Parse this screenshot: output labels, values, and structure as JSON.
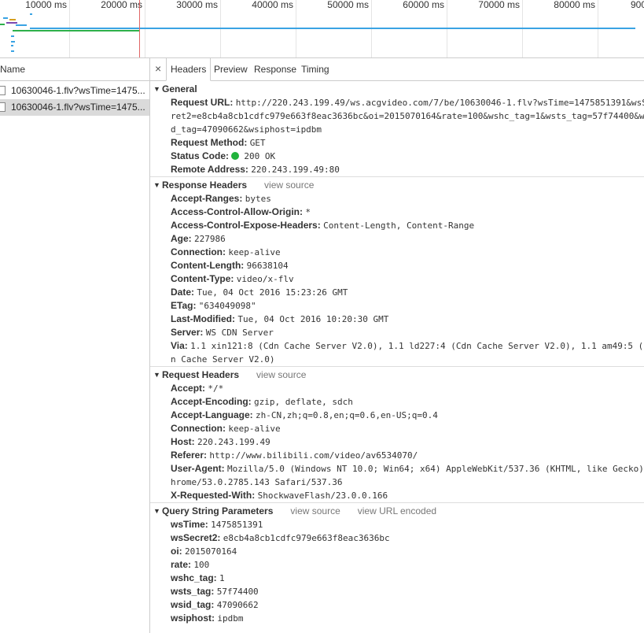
{
  "overview": {
    "ticks": [
      "10000 ms",
      "20000 ms",
      "30000 ms",
      "40000 ms",
      "50000 ms",
      "60000 ms",
      "70000 ms",
      "80000 ms",
      "900"
    ]
  },
  "request_list": {
    "header": "Name",
    "rows": [
      "10630046-1.flv?wsTime=1475...",
      "10630046-1.flv?wsTime=1475..."
    ]
  },
  "tabs": {
    "close": "×",
    "items": [
      "Headers",
      "Preview",
      "Response",
      "Timing"
    ],
    "active": "Headers"
  },
  "general": {
    "title": "General",
    "request_url_label": "Request URL:",
    "request_url_l1": "http://220.243.199.49/ws.acgvideo.com/7/be/10630046-1.flv?wsTime=1475851391&wsS",
    "request_url_l2": "ret2=e8cb4a8cb1cdfc979e663f8eac3636bc&oi=2015070164&rate=100&wshc_tag=1&wsts_tag=57f74400&w",
    "request_url_l3": "d_tag=47090662&wsiphost=ipdbm",
    "method_label": "Request Method:",
    "method": "GET",
    "status_label": "Status Code:",
    "status": "200 OK",
    "remote_label": "Remote Address:",
    "remote": "220.243.199.49:80"
  },
  "response_headers": {
    "title": "Response Headers",
    "view_source": "view source",
    "items": [
      {
        "k": "Accept-Ranges:",
        "v": "bytes"
      },
      {
        "k": "Access-Control-Allow-Origin:",
        "v": "*"
      },
      {
        "k": "Access-Control-Expose-Headers:",
        "v": "Content-Length, Content-Range"
      },
      {
        "k": "Age:",
        "v": "227986"
      },
      {
        "k": "Connection:",
        "v": "keep-alive"
      },
      {
        "k": "Content-Length:",
        "v": "96638104"
      },
      {
        "k": "Content-Type:",
        "v": "video/x-flv"
      },
      {
        "k": "Date:",
        "v": "Tue, 04 Oct 2016 15:23:26 GMT"
      },
      {
        "k": "ETag:",
        "v": "\"634049098\""
      },
      {
        "k": "Last-Modified:",
        "v": "Tue, 04 Oct 2016 10:20:30 GMT"
      },
      {
        "k": "Server:",
        "v": "WS CDN Server"
      },
      {
        "k": "Via:",
        "v": "1.1 xin121:8 (Cdn Cache Server V2.0), 1.1 ld227:4 (Cdn Cache Server V2.0), 1.1 am49:5 ("
      }
    ],
    "via_cont": "n Cache Server V2.0)"
  },
  "request_headers": {
    "title": "Request Headers",
    "view_source": "view source",
    "items": [
      {
        "k": "Accept:",
        "v": "*/*"
      },
      {
        "k": "Accept-Encoding:",
        "v": "gzip, deflate, sdch"
      },
      {
        "k": "Accept-Language:",
        "v": "zh-CN,zh;q=0.8,en;q=0.6,en-US;q=0.4"
      },
      {
        "k": "Connection:",
        "v": "keep-alive"
      },
      {
        "k": "Host:",
        "v": "220.243.199.49"
      },
      {
        "k": "Referer:",
        "v": "http://www.bilibili.com/video/av6534070/"
      },
      {
        "k": "User-Agent:",
        "v": "Mozilla/5.0 (Windows NT 10.0; Win64; x64) AppleWebKit/537.36 (KHTML, like Gecko)"
      }
    ],
    "ua_cont": "hrome/53.0.2785.143 Safari/537.36",
    "xrw_label": "X-Requested-With:",
    "xrw": "ShockwaveFlash/23.0.0.166"
  },
  "query": {
    "title": "Query String Parameters",
    "view_source": "view source",
    "view_url_encoded": "view URL encoded",
    "items": [
      {
        "k": "wsTime:",
        "v": "1475851391"
      },
      {
        "k": "wsSecret2:",
        "v": "e8cb4a8cb1cdfc979e663f8eac3636bc"
      },
      {
        "k": "oi:",
        "v": "2015070164"
      },
      {
        "k": "rate:",
        "v": "100"
      },
      {
        "k": "wshc_tag:",
        "v": "1"
      },
      {
        "k": "wsts_tag:",
        "v": "57f74400"
      },
      {
        "k": "wsid_tag:",
        "v": "47090662"
      },
      {
        "k": "wsiphost:",
        "v": "ipdbm"
      }
    ]
  },
  "colors": {
    "status_ok": "#21b33c",
    "timeline_blue": "#3aa3e3",
    "timeline_green": "#2db04b",
    "marker_red": "#e06666"
  }
}
